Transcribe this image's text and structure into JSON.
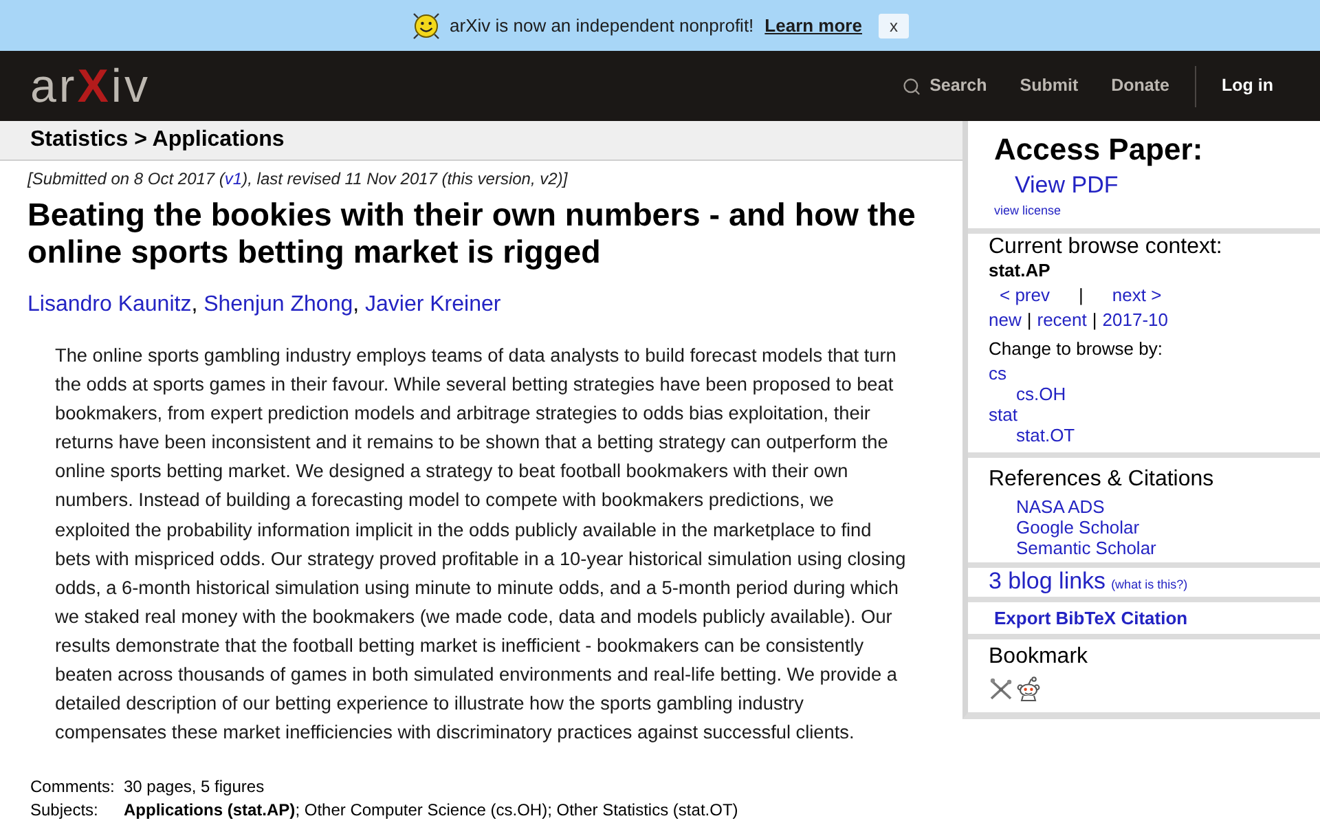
{
  "banner": {
    "message": "arXiv is now an independent nonprofit!",
    "link": "Learn more",
    "close": "x"
  },
  "header": {
    "logo": [
      "ar",
      "X",
      "iv"
    ],
    "nav": [
      {
        "label": "Search",
        "kind": "search"
      },
      {
        "label": "Submit",
        "kind": "link"
      },
      {
        "label": "Donate",
        "kind": "link"
      },
      {
        "label": "Log in",
        "kind": "login"
      }
    ]
  },
  "breadcrumb": "Statistics > Applications",
  "paper": {
    "submission": {
      "before": "[Submitted on 8 Oct 2017 (",
      "link": "v1",
      "after": "), last revised 11 Nov 2017 (this version, v2)]"
    },
    "title": "Beating the bookies with their own numbers - and how the online sports betting market is rigged",
    "authors": [
      "Lisandro Kaunitz",
      "Shenjun Zhong",
      "Javier Kreiner"
    ],
    "author_separator": ",",
    "abstract": "The online sports gambling industry employs teams of data analysts to build forecast models that turn the odds at sports games in their favour. While several betting strategies have been proposed to beat bookmakers, from expert prediction models and arbitrage strategies to odds bias exploitation, their returns have been inconsistent and it remains to be shown that a betting strategy can outperform the online sports betting market. We designed a strategy to beat football bookmakers with their own numbers. Instead of building a forecasting model to compete with bookmakers predictions, we exploited the probability information implicit in the odds publicly available in the marketplace to find bets with mispriced odds. Our strategy proved profitable in a 10-year historical simulation using closing odds, a 6-month historical simulation using minute to minute odds, and a 5-month period during which we staked real money with the bookmakers (we made code, data and models publicly available). Our results demonstrate that the football betting market is inefficient - bookmakers can be consistently beaten across thousands of games in both simulated environments and real-life betting. We provide a detailed description of our betting experience to illustrate how the sports gambling industry compensates these market inefficiencies with discriminatory practices against successful clients.",
    "metadata": [
      {
        "label": "Comments:",
        "value": "30 pages, 5 figures"
      },
      {
        "label": "Subjects:",
        "value": "**Applications (stat.AP)**; Other Computer Science (cs.OH); Other Statistics (stat.OT)"
      }
    ]
  },
  "sidebar": {
    "access": {
      "heading": "Access Paper:",
      "links": [
        "View PDF"
      ],
      "license": "view license"
    },
    "browse": {
      "heading": "Current browse context:",
      "context": "stat.AP",
      "prev": "< prev",
      "divider": "|",
      "next": "next >",
      "lists": [
        "new",
        "recent",
        "2017-10"
      ],
      "separator": "|",
      "change_label": "Change to browse by:",
      "categories": [
        {
          "label": "cs",
          "children": [
            {
              "label": "cs.OH"
            }
          ]
        },
        {
          "label": "stat",
          "children": [
            {
              "label": "stat.OT"
            }
          ]
        }
      ]
    },
    "references": {
      "heading": "References & Citations",
      "links": [
        "NASA ADS",
        "Google Scholar",
        "Semantic Scholar"
      ]
    },
    "blog": {
      "label": "3 blog links",
      "note": "(what is this?)"
    },
    "export": "Export BibTeX Citation",
    "bookmark": {
      "heading": "Bookmark",
      "services": [
        {
          "kind": "tools"
        },
        {
          "kind": "alien"
        }
      ]
    }
  }
}
